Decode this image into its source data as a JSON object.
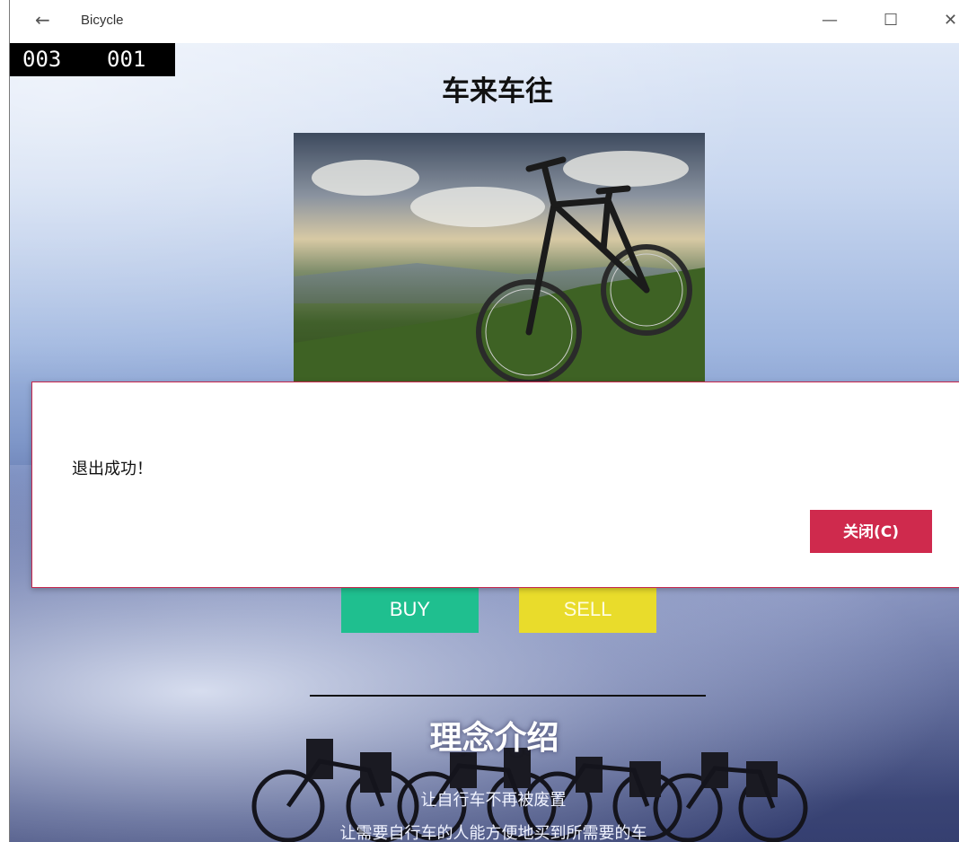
{
  "window": {
    "title": "Bicycle",
    "back_icon": "←",
    "minimize_icon": "—",
    "maximize_icon": "☐",
    "close_icon": "✕"
  },
  "counter": {
    "left": "003",
    "right": "001"
  },
  "page": {
    "title": "车来车往",
    "buy_label": "BUY",
    "sell_label": "SELL",
    "section_title": "理念介绍",
    "intro_line1": "让自行车不再被废置",
    "intro_line2": "让需要自行车的人能方便地买到所需要的车"
  },
  "dialog": {
    "message": "退出成功！",
    "close_label": "关闭(C)"
  },
  "colors": {
    "buy": "#1fbf8f",
    "sell": "#e9dc2b",
    "dialog_accent": "#cf2a4d"
  }
}
